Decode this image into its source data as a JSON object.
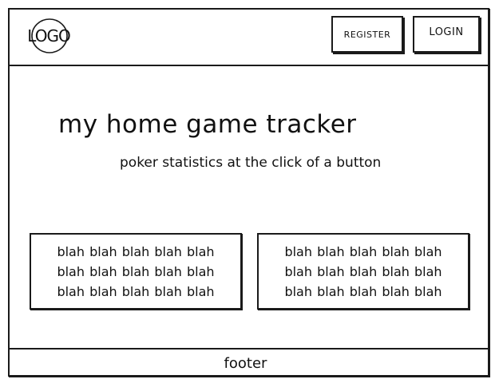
{
  "header": {
    "logo_text": "LOGO",
    "nav": {
      "register_label": "REGISTER",
      "login_label": "LOGIN"
    }
  },
  "hero": {
    "title": "my home game tracker",
    "subtitle": "poker statistics at the click of a button"
  },
  "cards": [
    {
      "text": "blah blah blah blah blah blah blah blah blah blah blah blah blah blah blah"
    },
    {
      "text": "blah blah blah blah blah blah blah blah blah blah blah blah blah blah blah"
    }
  ],
  "footer": {
    "text": "footer"
  }
}
